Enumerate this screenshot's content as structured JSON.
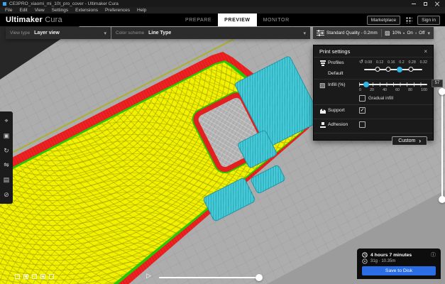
{
  "window": {
    "title": "CE3PRO_xiaomi_mi_10t_pro_cover - Ultimaker Cura"
  },
  "menu": {
    "items": [
      "File",
      "Edit",
      "View",
      "Settings",
      "Extensions",
      "Preferences",
      "Help"
    ]
  },
  "header": {
    "logo_bold": "Ultimaker",
    "logo_light": "Cura",
    "tabs": [
      {
        "label": "PREPARE"
      },
      {
        "label": "PREVIEW"
      },
      {
        "label": "MONITOR"
      }
    ],
    "active_tab": "PREVIEW",
    "marketplace_label": "Marketplace",
    "signin_label": "Sign in"
  },
  "toolbar": {
    "view_type_label": "View type",
    "view_type_value": "Layer view",
    "color_scheme_label": "Color scheme",
    "color_scheme_value": "Line Type",
    "profile_summary": "Standard Quality - 0.2mm",
    "infill_value": "10%",
    "support_value": "On",
    "adhesion_value": "Off"
  },
  "print_settings": {
    "title": "Print settings",
    "profiles_label": "Profiles",
    "default_label": "Default",
    "profile_ticks": [
      "0.08",
      "0.12",
      "0.16",
      "0.2",
      "0.28",
      "0.32"
    ],
    "selected_profile": "0.2",
    "infill_label": "Infill (%)",
    "infill_percent": 10,
    "infill_ticks": [
      "0",
      "20",
      "40",
      "60",
      "80",
      "100"
    ],
    "gradual_infill_label": "Gradual infill",
    "gradual_infill_checked": false,
    "support_label": "Support",
    "support_checked": true,
    "adhesion_label": "Adhesion",
    "adhesion_checked": false,
    "custom_label": "Custom"
  },
  "preview": {
    "current_layer": "57"
  },
  "stats": {
    "print_time": "4 hours 7 minutes",
    "material_usage": "31g · 10.35m",
    "save_button_label": "Save to Disk"
  },
  "icons": {
    "chevron": "▾",
    "reset": "↺",
    "close": "×",
    "play": "▷",
    "info": "ⓘ",
    "forward": "›",
    "check": "✓",
    "infill": "▨",
    "tools": [
      "⌖",
      "▣",
      "↻",
      "⇋",
      "▤",
      "⊘"
    ]
  },
  "colors": {
    "accent_blue": "#32b4e4",
    "primary_button_blue": "#2a6de5",
    "infill_yellow": "#f2f200",
    "wall_red": "#ee2222",
    "inner_wall_green": "#28c800",
    "support_cyan": "#46ccd9",
    "active_tab_bg": "#ffffff"
  }
}
